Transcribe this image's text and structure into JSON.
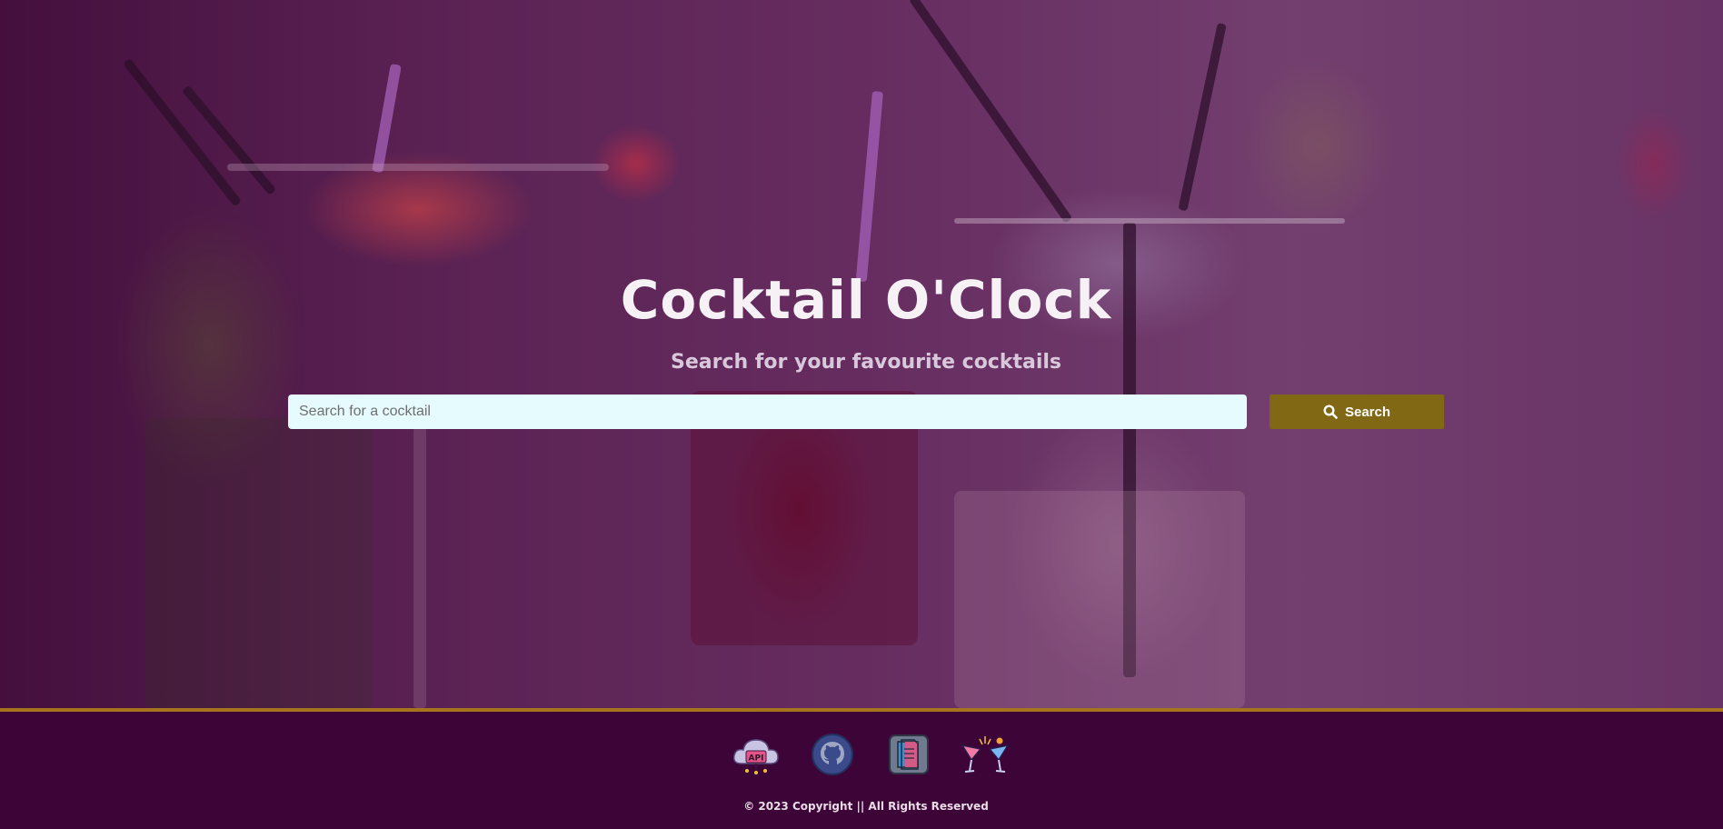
{
  "hero": {
    "title": "Cocktail O'Clock",
    "subtitle": "Search for your favourite cocktails"
  },
  "search": {
    "placeholder": "Search for a cocktail",
    "value": "",
    "button_label": "Search",
    "button_icon": "search-icon"
  },
  "footer": {
    "links": [
      {
        "icon": "api-cloud-icon"
      },
      {
        "icon": "github-icon"
      },
      {
        "icon": "document-icon"
      },
      {
        "icon": "cocktail-cheers-icon"
      }
    ],
    "copyright": "© 2023 Copyright || All Rights Reserved"
  },
  "colors": {
    "footer_background": "#3d0438",
    "footer_border": "#a7741e",
    "search_button": "#806815",
    "search_input": "#e6fbfd"
  }
}
